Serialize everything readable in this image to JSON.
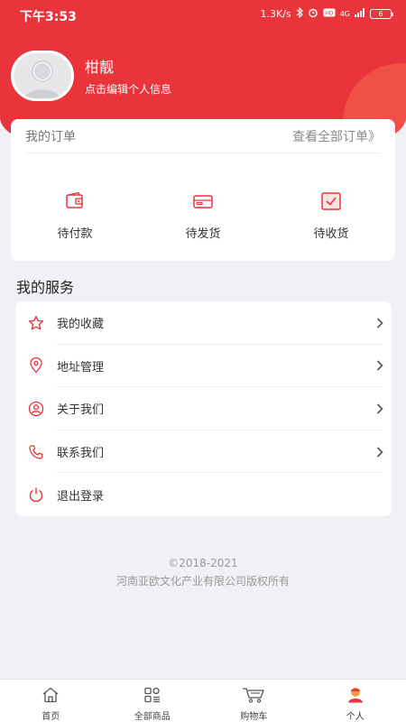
{
  "status_bar": {
    "time": "下午3:53",
    "speed": "1.3K/s",
    "network": "4G",
    "battery": "6"
  },
  "profile": {
    "name": "柑靓",
    "subtitle": "点击编辑个人信息"
  },
  "orders": {
    "title": "我的订单",
    "view_all": "查看全部订单》",
    "items": [
      {
        "label": "待付款",
        "icon": "wallet-icon"
      },
      {
        "label": "待发货",
        "icon": "box-icon"
      },
      {
        "label": "待收货",
        "icon": "receive-icon"
      }
    ]
  },
  "services": {
    "title": "我的服务",
    "items": [
      {
        "label": "我的收藏",
        "icon": "star-icon"
      },
      {
        "label": "地址管理",
        "icon": "location-icon"
      },
      {
        "label": "关于我们",
        "icon": "user-circle-icon"
      },
      {
        "label": "联系我们",
        "icon": "phone-icon"
      },
      {
        "label": "退出登录",
        "icon": "power-icon"
      }
    ]
  },
  "footer": {
    "copyright": "©2018-2021",
    "company": "河南亚欧文化产业有限公司版权所有"
  },
  "tabbar": {
    "items": [
      {
        "label": "首页",
        "icon": "home-icon"
      },
      {
        "label": "全部商品",
        "icon": "grid-icon"
      },
      {
        "label": "购物车",
        "icon": "cart-icon"
      },
      {
        "label": "个人",
        "icon": "person-icon"
      }
    ]
  },
  "colors": {
    "brand": "#e8343a",
    "background": "#f1f1f5",
    "text": "#333333"
  }
}
